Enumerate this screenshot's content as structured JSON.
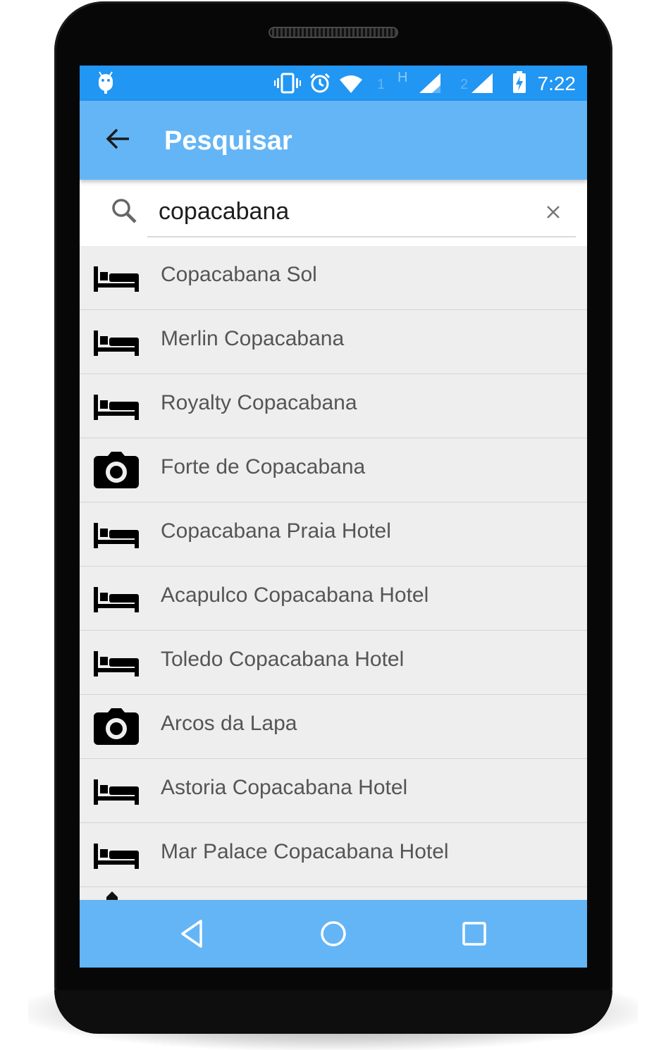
{
  "status_bar": {
    "time": "7:22",
    "sim1_label": "1",
    "sim2_label": "2",
    "network_type": "H",
    "icons": [
      "android-debug-icon",
      "vibrate-icon",
      "alarm-icon",
      "wifi-icon",
      "signal-icon",
      "battery-charging-icon"
    ]
  },
  "app_bar": {
    "title": "Pesquisar",
    "back_icon": "arrow-back-icon"
  },
  "search": {
    "value": "copacabana",
    "icon": "search-icon",
    "clear_icon": "close-icon"
  },
  "results": [
    {
      "label": "Copacabana Sol",
      "icon": "hotel-bed-icon"
    },
    {
      "label": "Merlin Copacabana",
      "icon": "hotel-bed-icon"
    },
    {
      "label": "Royalty Copacabana",
      "icon": "hotel-bed-icon"
    },
    {
      "label": "Forte de Copacabana",
      "icon": "camera-icon"
    },
    {
      "label": "Copacabana Praia Hotel",
      "icon": "hotel-bed-icon"
    },
    {
      "label": "Acapulco Copacabana Hotel",
      "icon": "hotel-bed-icon"
    },
    {
      "label": "Toledo Copacabana Hotel",
      "icon": "hotel-bed-icon"
    },
    {
      "label": "Arcos da Lapa",
      "icon": "camera-icon"
    },
    {
      "label": "Astoria Copacabana Hotel",
      "icon": "hotel-bed-icon"
    },
    {
      "label": "Mar Palace Copacabana Hotel",
      "icon": "hotel-bed-icon"
    }
  ],
  "nav_bar": {
    "icons": [
      "nav-back-icon",
      "nav-home-icon",
      "nav-recents-icon"
    ]
  },
  "colors": {
    "status_bar": "#2196f3",
    "app_bar": "#64b5f6",
    "list_background": "#eeeeee",
    "list_text": "#555555"
  }
}
